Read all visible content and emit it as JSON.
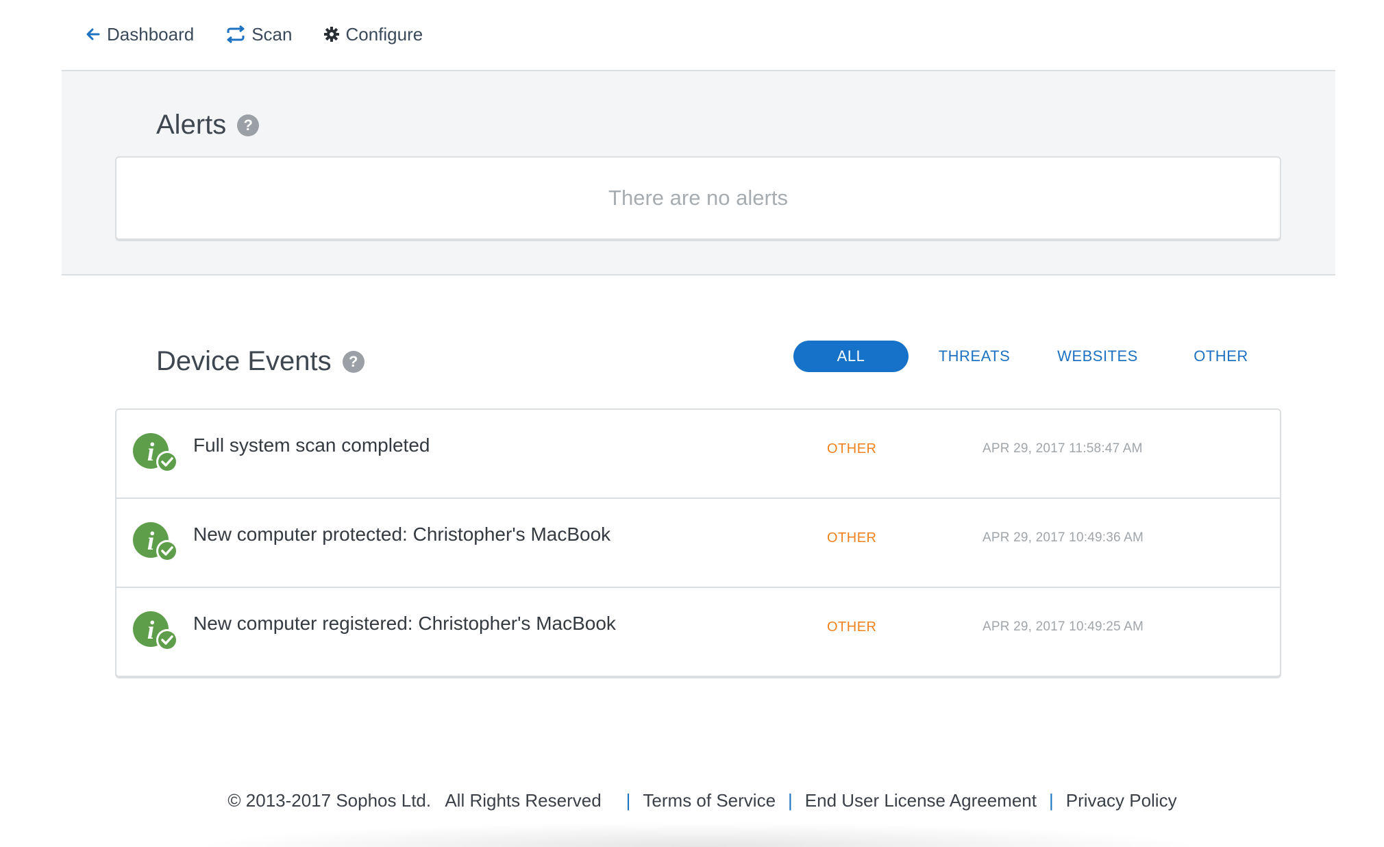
{
  "nav": {
    "dashboard_label": "Dashboard",
    "scan_label": "Scan",
    "configure_label": "Configure"
  },
  "alerts": {
    "title": "Alerts",
    "help": "?",
    "empty_message": "There are no alerts"
  },
  "device_events": {
    "title": "Device Events",
    "help": "?",
    "filters": [
      {
        "label": "ALL",
        "active": true
      },
      {
        "label": "THREATS",
        "active": false
      },
      {
        "label": "WEBSITES",
        "active": false
      },
      {
        "label": "OTHER",
        "active": false
      }
    ],
    "events": [
      {
        "icon": "info-check-icon",
        "text": "Full system scan completed",
        "category": "OTHER",
        "timestamp": "APR 29, 2017 11:58:47 AM"
      },
      {
        "icon": "info-check-icon",
        "text": "New computer protected: Christopher's MacBook",
        "category": "OTHER",
        "timestamp": "APR 29, 2017 10:49:36 AM"
      },
      {
        "icon": "info-check-icon",
        "text": "New computer registered: Christopher's MacBook",
        "category": "OTHER",
        "timestamp": "APR 29, 2017 10:49:25 AM"
      }
    ]
  },
  "footer": {
    "copyright": "© 2013-2017 Sophos Ltd.   All Rights Reserved",
    "terms": "Terms of Service",
    "eula": "End User License Agreement",
    "privacy": "Privacy Policy",
    "separator": "|"
  },
  "colors": {
    "accent": "#1672c8",
    "category": "#f0821e",
    "event_icon": "#5e9e4a",
    "band_bg": "#f4f5f6"
  }
}
